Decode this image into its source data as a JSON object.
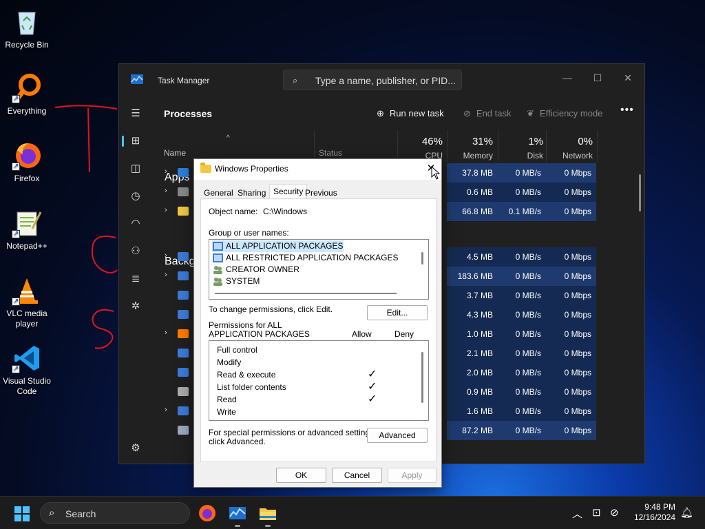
{
  "desktop": {
    "icons": [
      {
        "label": "Recycle Bin"
      },
      {
        "label": "Everything"
      },
      {
        "label": "Firefox"
      },
      {
        "label": "Notepad++"
      },
      {
        "label": "VLC media player"
      },
      {
        "label": "Visual Studio Code"
      }
    ]
  },
  "task_manager": {
    "title": "Task Manager",
    "search_placeholder": "Type a name, publisher, or PID...",
    "page_title": "Processes",
    "run_new_task": "Run new task",
    "end_task": "End task",
    "efficiency_mode": "Efficiency mode",
    "columns": {
      "name": "Name",
      "status": "Status",
      "cpu_pct": "46%",
      "cpu": "CPU",
      "mem_pct": "31%",
      "mem": "Memory",
      "disk_pct": "1%",
      "disk": "Disk",
      "net_pct": "0%",
      "net": "Network"
    },
    "groups": {
      "apps": "Apps (",
      "background": "Backgr"
    },
    "rows": [
      {
        "mem": "37.8 MB",
        "disk": "0 MB/s",
        "net": "0 Mbps"
      },
      {
        "mem": "0.6 MB",
        "disk": "0 MB/s",
        "net": "0 Mbps"
      },
      {
        "mem": "66.8 MB",
        "disk": "0.1 MB/s",
        "net": "0 Mbps"
      },
      {
        "mem": "4.5 MB",
        "disk": "0 MB/s",
        "net": "0 Mbps"
      },
      {
        "mem": "183.6 MB",
        "disk": "0 MB/s",
        "net": "0 Mbps"
      },
      {
        "mem": "3.7 MB",
        "disk": "0 MB/s",
        "net": "0 Mbps"
      },
      {
        "mem": "4.3 MB",
        "disk": "0 MB/s",
        "net": "0 Mbps"
      },
      {
        "mem": "1.0 MB",
        "disk": "0 MB/s",
        "net": "0 Mbps"
      },
      {
        "mem": "2.1 MB",
        "disk": "0 MB/s",
        "net": "0 Mbps"
      },
      {
        "mem": "2.0 MB",
        "disk": "0 MB/s",
        "net": "0 Mbps"
      },
      {
        "mem": "0.9 MB",
        "disk": "0 MB/s",
        "net": "0 Mbps"
      },
      {
        "mem": "1.6 MB",
        "disk": "0 MB/s",
        "net": "0 Mbps"
      },
      {
        "mem": "87.2 MB",
        "disk": "0 MB/s",
        "net": "0 Mbps"
      }
    ]
  },
  "dialog": {
    "title": "Windows Properties",
    "tabs": [
      "General",
      "Sharing",
      "Security",
      "Previous Versions"
    ],
    "object_name_label": "Object name:",
    "object_name_value": "C:\\Windows",
    "group_label": "Group or user names:",
    "groups": [
      "ALL APPLICATION PACKAGES",
      "ALL RESTRICTED APPLICATION PACKAGES",
      "CREATOR OWNER",
      "SYSTEM"
    ],
    "change_hint": "To change permissions, click Edit.",
    "edit_button": "Edit...",
    "perm_label_line1": "Permissions for ALL",
    "perm_label_line2": "APPLICATION PACKAGES",
    "allow": "Allow",
    "deny": "Deny",
    "permissions": [
      {
        "name": "Full control",
        "allow": ""
      },
      {
        "name": "Modify",
        "allow": ""
      },
      {
        "name": "Read & execute",
        "allow": "✓"
      },
      {
        "name": "List folder contents",
        "allow": "✓"
      },
      {
        "name": "Read",
        "allow": "✓"
      },
      {
        "name": "Write",
        "allow": ""
      }
    ],
    "special_line1": "For special permissions or advanced settings,",
    "special_line2": "click Advanced.",
    "advanced_button": "Advanced",
    "ok": "OK",
    "cancel": "Cancel",
    "apply": "Apply"
  },
  "taskbar": {
    "search_placeholder": "Search",
    "time": "9:48 PM",
    "date": "12/16/2024"
  },
  "colors": {
    "accent": "#4cc2ff",
    "highlight_cell": "#1e3a6e",
    "scribble": "#e0141e"
  }
}
